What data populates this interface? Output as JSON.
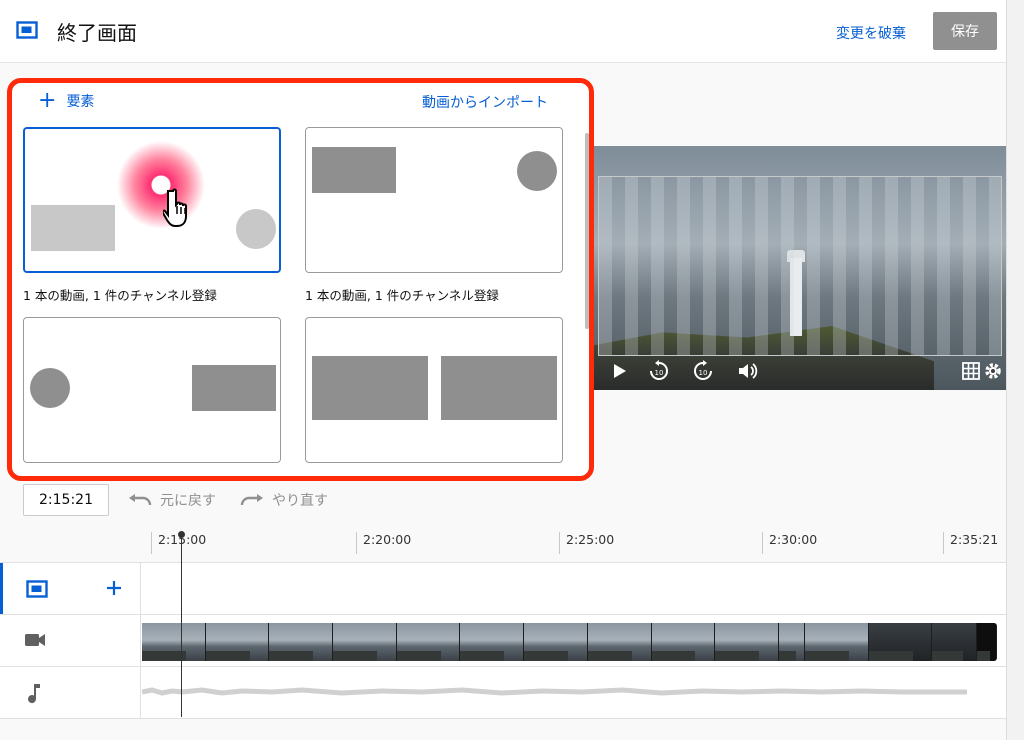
{
  "header": {
    "title": "終了画面",
    "discard_label": "変更を破棄",
    "save_label": "保存"
  },
  "panel": {
    "add_label": "要素",
    "import_label": "動画からインポート",
    "templates": [
      {
        "caption": "1 本の動画, 1 件のチャンネル登録",
        "selected": true
      },
      {
        "caption": "1 本の動画, 1 件のチャンネル登録",
        "selected": false
      },
      {
        "caption": "",
        "selected": false
      },
      {
        "caption": "",
        "selected": false
      }
    ]
  },
  "toolbar": {
    "current_time": "2:15:21",
    "undo_label": "元に戻す",
    "redo_label": "やり直す"
  },
  "timeline": {
    "ticks": [
      "2:15:00",
      "2:20:00",
      "2:25:00",
      "2:30:00",
      "2:35:21"
    ]
  },
  "icons": {
    "app": "end-screen-icon",
    "play": "play-icon",
    "rewind": "rewind-10-icon",
    "forward": "forward-10-icon",
    "volume": "volume-icon",
    "grid": "grid-icon",
    "settings": "gear-icon",
    "video_track": "video-camera-icon",
    "audio_track": "music-note-icon"
  },
  "colors": {
    "accent": "#065fd4",
    "highlight": "#ff2a0a",
    "save_disabled": "#909090"
  }
}
